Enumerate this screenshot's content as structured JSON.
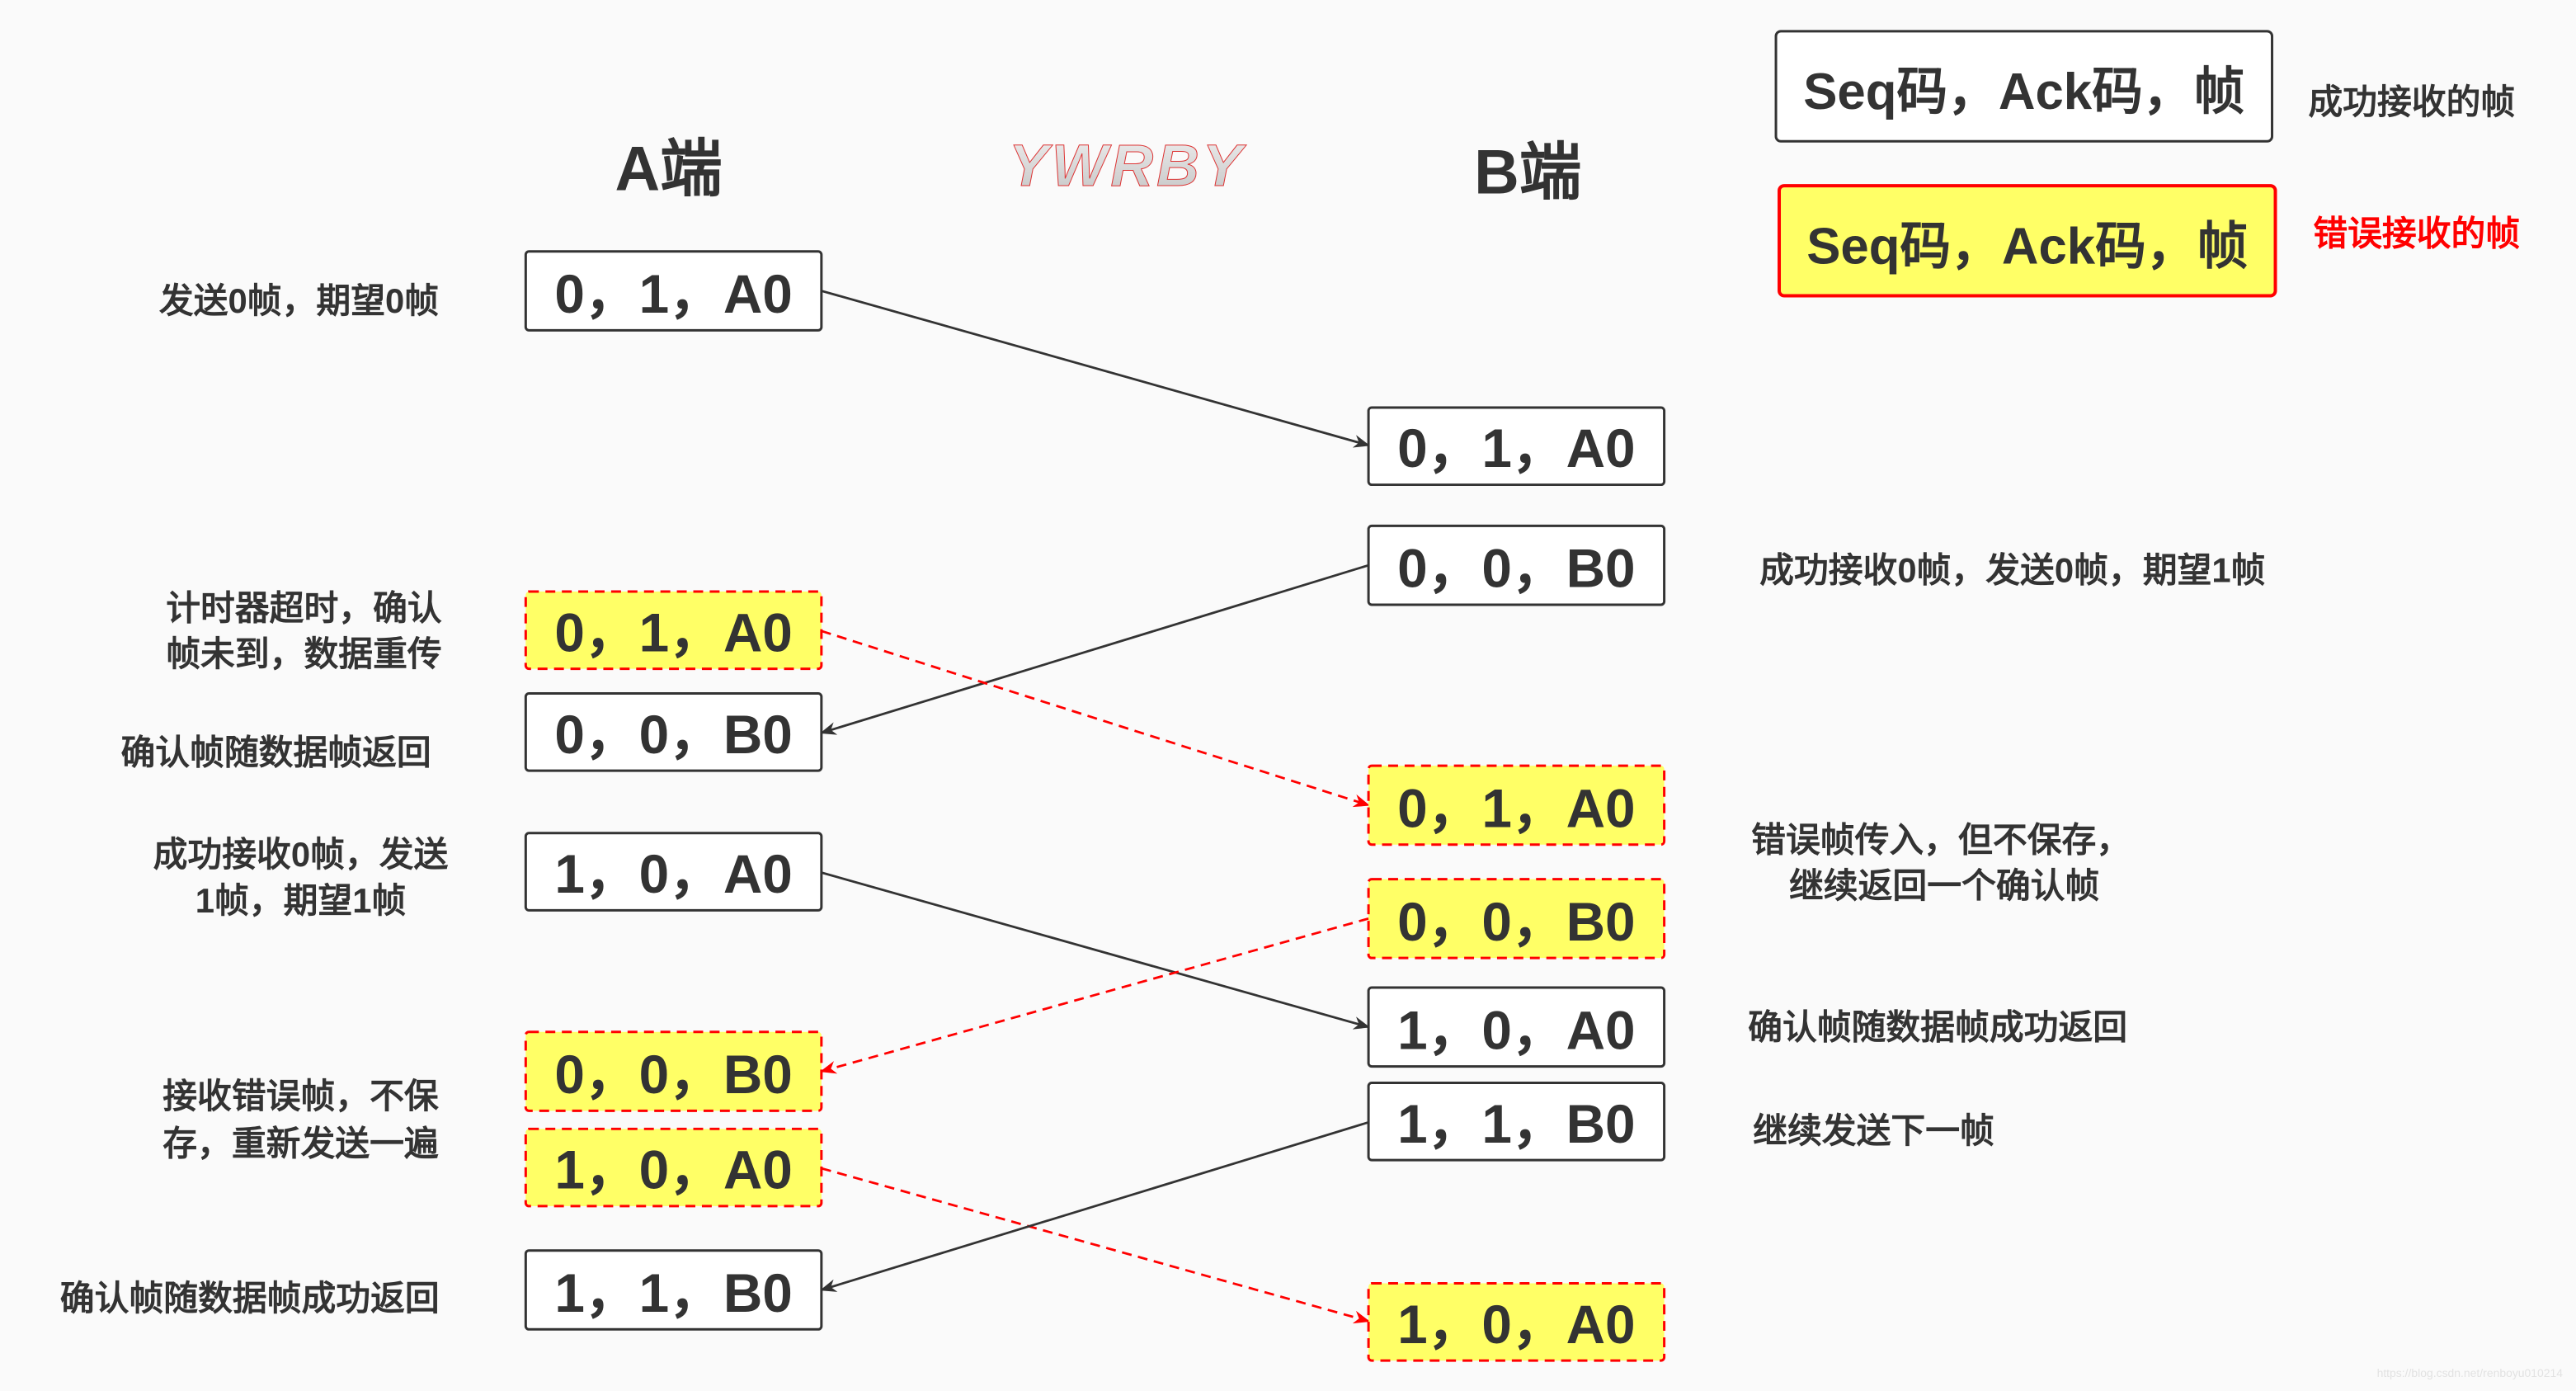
{
  "headers": {
    "a_side": "A端",
    "b_side": "B端"
  },
  "logo": "YWRBY",
  "legend": {
    "box_text": "Seq码，Ack码，帧",
    "success_label": "成功接收的帧",
    "error_label": "错误接收的帧",
    "error_color": "#ff0000",
    "error_fill": "#ffff66"
  },
  "a_frames": [
    {
      "text": "0，1，A0",
      "status": "success"
    },
    {
      "text": "0，1，A0",
      "status": "error"
    },
    {
      "text": "0，0，B0",
      "status": "success"
    },
    {
      "text": "1，0，A0",
      "status": "success"
    },
    {
      "text": "0，0，B0",
      "status": "error"
    },
    {
      "text": "1，0，A0",
      "status": "error"
    },
    {
      "text": "1，1，B0",
      "status": "success"
    }
  ],
  "b_frames": [
    {
      "text": "0，1，A0",
      "status": "success"
    },
    {
      "text": "0，0，B0",
      "status": "success"
    },
    {
      "text": "0，1，A0",
      "status": "error"
    },
    {
      "text": "0，0，B0",
      "status": "error"
    },
    {
      "text": "1，0，A0",
      "status": "success"
    },
    {
      "text": "1，1，B0",
      "status": "success"
    },
    {
      "text": "1，0，A0",
      "status": "error"
    }
  ],
  "a_notes": [
    [
      "发送0帧，期望0帧"
    ],
    [
      "计时器超时，确认",
      "帧未到，数据重传"
    ],
    [
      "确认帧随数据帧返回"
    ],
    [
      "成功接收0帧，发送",
      "1帧，期望1帧"
    ],
    [
      "接收错误帧，不保",
      "存，重新发送一遍"
    ],
    [
      "确认帧随数据帧成功返回"
    ]
  ],
  "b_notes": [
    [
      "成功接收0帧，发送0帧，期望1帧"
    ],
    [
      "错误帧传入，但不保存，",
      "继续返回一个确认帧"
    ],
    [
      "确认帧随数据帧成功返回"
    ],
    [
      "继续发送下一帧"
    ]
  ],
  "watermark": "https://blog.csdn.net/renboyu010214"
}
